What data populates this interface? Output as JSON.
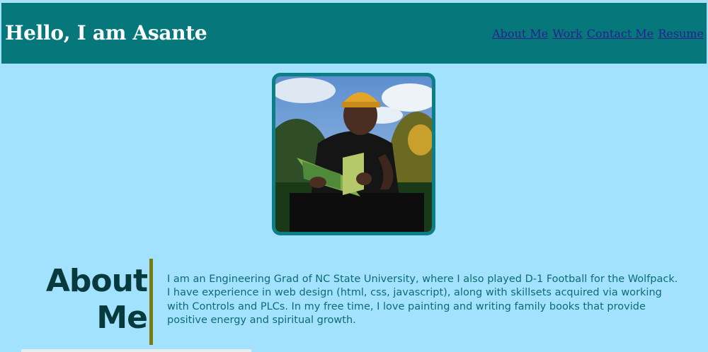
{
  "header": {
    "title": "Hello, I am Asante",
    "nav": [
      {
        "label": "About Me"
      },
      {
        "label": "Work"
      },
      {
        "label": "Contact Me"
      },
      {
        "label": "Resume"
      }
    ]
  },
  "profile_photo": {
    "subject": "man in yellow cap reading a book outdoors",
    "border_color": "#0b7e86"
  },
  "about": {
    "heading_line1": "About",
    "heading_line2": "Me",
    "text": "I am an Engineering Grad of NC State University, where I also played D-1 Football for the Wolfpack. I have experience in web design (html, css, javascript), along with skillsets acquired via working with Controls and PLCs. In my free time, I love painting and writing family books that provide positive energy and spiritual growth."
  },
  "colors": {
    "page_background": "#a2e2ff",
    "header_background": "#06787c",
    "header_text": "#ffffff",
    "nav_link": "#2a1f8f",
    "about_heading": "#073a3c",
    "about_bar": "#7b7a10",
    "about_text": "#0c6c70"
  }
}
